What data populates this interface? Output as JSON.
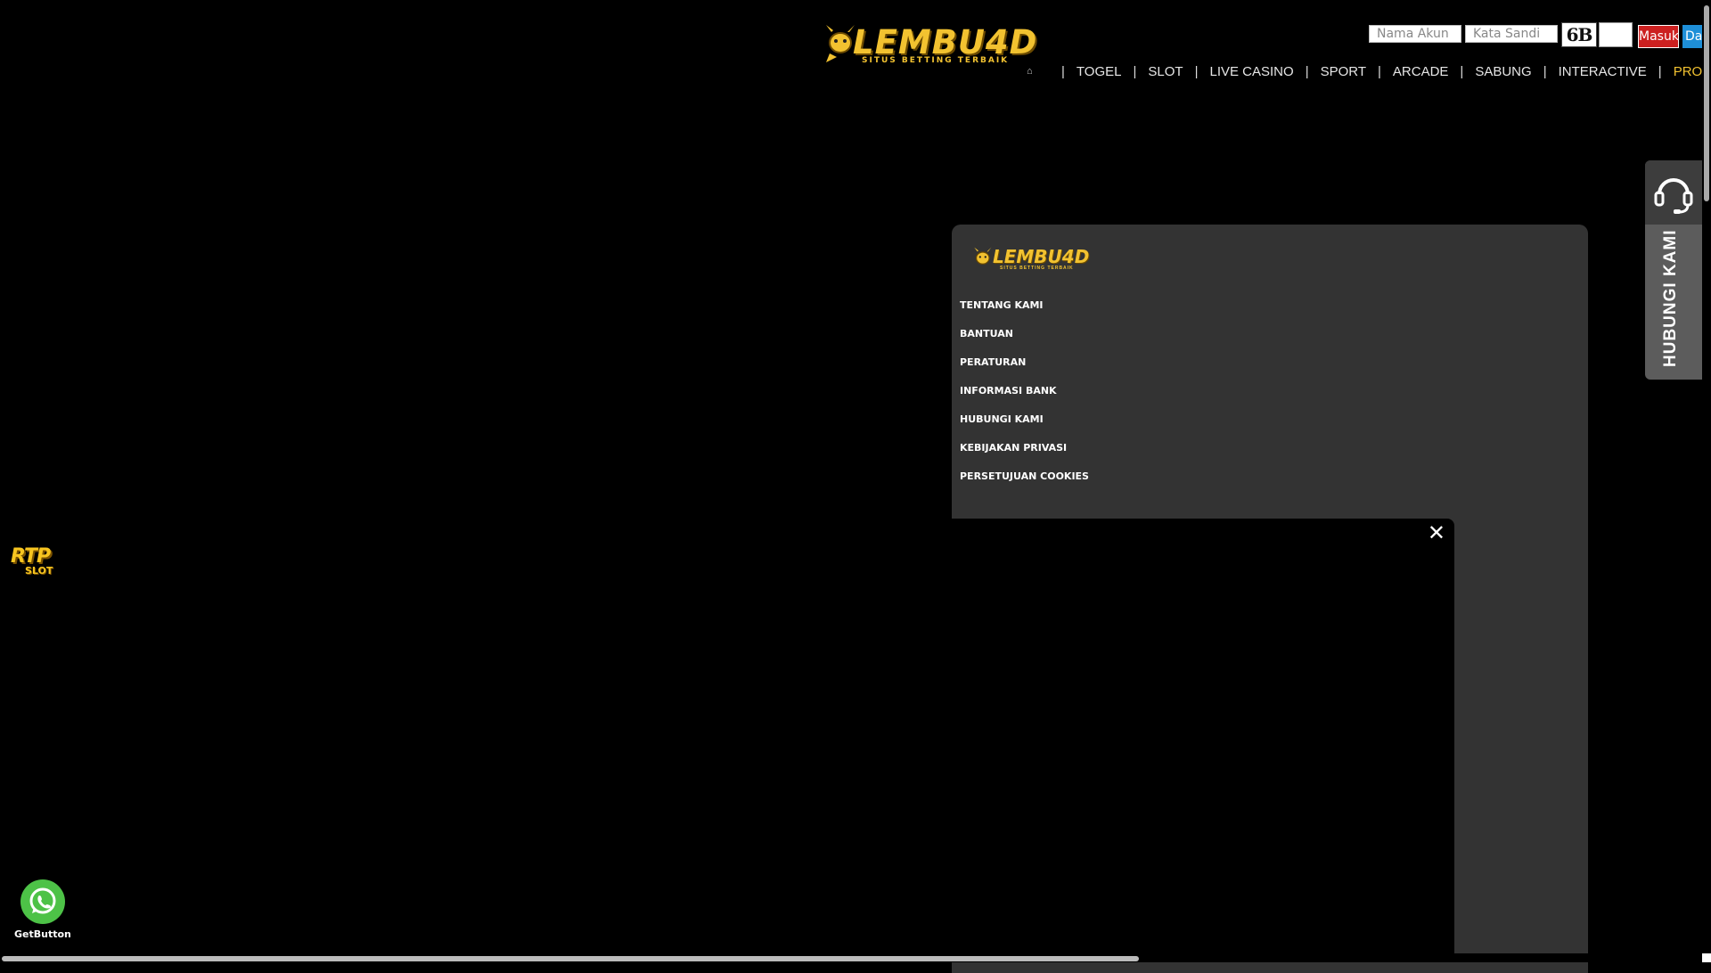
{
  "header": {
    "brand": "LEMBU4D",
    "tagline": "SITUS BETTING TERBAIK",
    "login": {
      "username_placeholder": "Nama Akun",
      "password_placeholder": "Kata Sandi",
      "captcha": "6B",
      "login_label": "Masuk",
      "register_label": "Dat"
    },
    "nav": {
      "home_icon": "home-icon",
      "items": [
        "TOGEL",
        "SLOT",
        "LIVE CASINO",
        "SPORT",
        "ARCADE",
        "SABUNG",
        "INTERACTIVE"
      ],
      "promo": "PROMOS"
    }
  },
  "contact_tab": {
    "icon": "headset-icon",
    "label": "HUBUNGI KAMI"
  },
  "footer": {
    "brand": "LEMBU4D",
    "tagline": "SITUS BETTING TERBAIK",
    "links": [
      "TENTANG KAMI",
      "BANTUAN",
      "PERATURAN",
      "INFORMASI BANK",
      "HUBUNGI KAMI",
      "KEBIJAKAN PRIVASI",
      "PERSETUJUAN COOKIES"
    ]
  },
  "popup": {
    "close_label": "✕"
  },
  "rtp": {
    "line1": "RTP",
    "line2": "SLOT"
  },
  "whatsapp": {
    "icon": "whatsapp-icon",
    "label": "GetButton"
  },
  "colors": {
    "gold": "#f2c230",
    "login_red": "#cc2020",
    "register_blue": "#1e8fd8",
    "whatsapp_green": "#4dc247",
    "panel": "#333333"
  }
}
